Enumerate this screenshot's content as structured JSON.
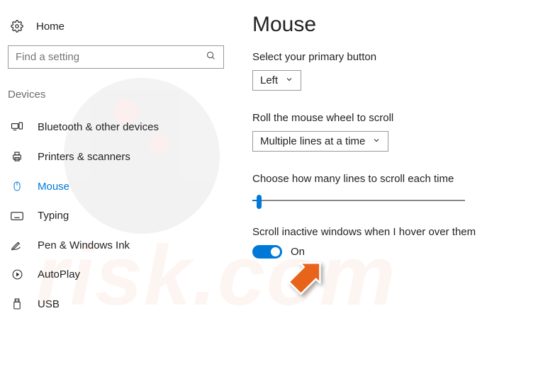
{
  "home_label": "Home",
  "search": {
    "placeholder": "Find a setting"
  },
  "section_header": "Devices",
  "nav": [
    {
      "label": "Bluetooth & other devices"
    },
    {
      "label": "Printers & scanners"
    },
    {
      "label": "Mouse"
    },
    {
      "label": "Typing"
    },
    {
      "label": "Pen & Windows Ink"
    },
    {
      "label": "AutoPlay"
    },
    {
      "label": "USB"
    }
  ],
  "page_title": "Mouse",
  "primary_button": {
    "label": "Select your primary button",
    "value": "Left"
  },
  "wheel_scroll": {
    "label": "Roll the mouse wheel to scroll",
    "value": "Multiple lines at a time"
  },
  "lines_label": "Choose how many lines to scroll each time",
  "inactive": {
    "label": "Scroll inactive windows when I hover over them",
    "state": "On"
  }
}
